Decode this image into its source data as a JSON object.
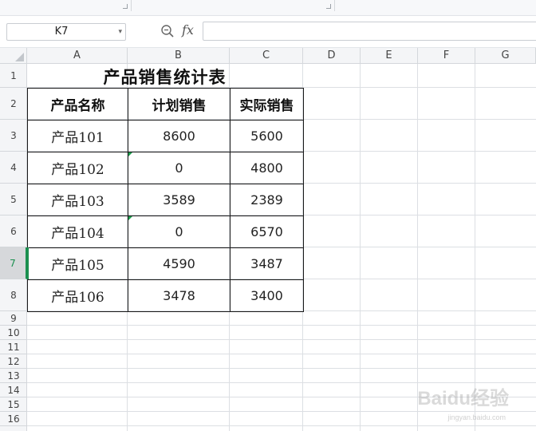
{
  "formula_bar": {
    "name_box": "K7",
    "fx_label": "fx",
    "formula": ""
  },
  "columns": [
    "A",
    "B",
    "C",
    "D",
    "E",
    "F",
    "G"
  ],
  "rows": [
    "1",
    "2",
    "3",
    "4",
    "5",
    "6",
    "7",
    "8",
    "9",
    "10",
    "11",
    "12",
    "13",
    "14",
    "15",
    "16"
  ],
  "active_row": "7",
  "sheet": {
    "title": "产品销售统计表",
    "headers": [
      "产品名称",
      "计划销售",
      "实际销售"
    ],
    "data": [
      [
        "产品101",
        "8600",
        "5600"
      ],
      [
        "产品102",
        "0",
        "4800"
      ],
      [
        "产品103",
        "3589",
        "2389"
      ],
      [
        "产品104",
        "0",
        "6570"
      ],
      [
        "产品105",
        "4590",
        "3487"
      ],
      [
        "产品106",
        "3478",
        "3400"
      ]
    ]
  },
  "icons": {
    "zoom": "zoom-formula-icon",
    "fx": "function-icon",
    "dropdown": "chevron-down-icon"
  },
  "watermark": {
    "main": "Baidu经验",
    "sub": "jingyan.baidu.com"
  },
  "colors": {
    "accent_green": "#1a8f4f",
    "grid_line": "#dcdfe3",
    "header_bg": "#f4f5f7"
  }
}
